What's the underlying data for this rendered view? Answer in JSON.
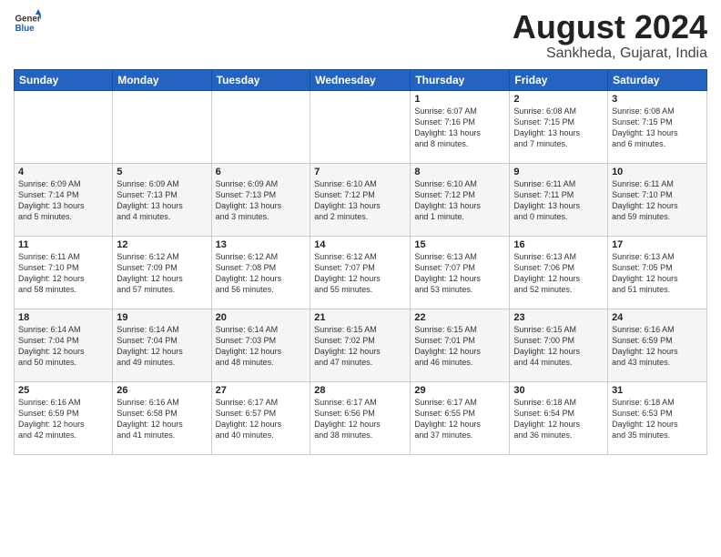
{
  "logo": {
    "general": "General",
    "blue": "Blue"
  },
  "title": "August 2024",
  "subtitle": "Sankheda, Gujarat, India",
  "days": [
    "Sunday",
    "Monday",
    "Tuesday",
    "Wednesday",
    "Thursday",
    "Friday",
    "Saturday"
  ],
  "weeks": [
    [
      {
        "num": "",
        "info": ""
      },
      {
        "num": "",
        "info": ""
      },
      {
        "num": "",
        "info": ""
      },
      {
        "num": "",
        "info": ""
      },
      {
        "num": "1",
        "info": "Sunrise: 6:07 AM\nSunset: 7:16 PM\nDaylight: 13 hours\nand 8 minutes."
      },
      {
        "num": "2",
        "info": "Sunrise: 6:08 AM\nSunset: 7:15 PM\nDaylight: 13 hours\nand 7 minutes."
      },
      {
        "num": "3",
        "info": "Sunrise: 6:08 AM\nSunset: 7:15 PM\nDaylight: 13 hours\nand 6 minutes."
      }
    ],
    [
      {
        "num": "4",
        "info": "Sunrise: 6:09 AM\nSunset: 7:14 PM\nDaylight: 13 hours\nand 5 minutes."
      },
      {
        "num": "5",
        "info": "Sunrise: 6:09 AM\nSunset: 7:13 PM\nDaylight: 13 hours\nand 4 minutes."
      },
      {
        "num": "6",
        "info": "Sunrise: 6:09 AM\nSunset: 7:13 PM\nDaylight: 13 hours\nand 3 minutes."
      },
      {
        "num": "7",
        "info": "Sunrise: 6:10 AM\nSunset: 7:12 PM\nDaylight: 13 hours\nand 2 minutes."
      },
      {
        "num": "8",
        "info": "Sunrise: 6:10 AM\nSunset: 7:12 PM\nDaylight: 13 hours\nand 1 minute."
      },
      {
        "num": "9",
        "info": "Sunrise: 6:11 AM\nSunset: 7:11 PM\nDaylight: 13 hours\nand 0 minutes."
      },
      {
        "num": "10",
        "info": "Sunrise: 6:11 AM\nSunset: 7:10 PM\nDaylight: 12 hours\nand 59 minutes."
      }
    ],
    [
      {
        "num": "11",
        "info": "Sunrise: 6:11 AM\nSunset: 7:10 PM\nDaylight: 12 hours\nand 58 minutes."
      },
      {
        "num": "12",
        "info": "Sunrise: 6:12 AM\nSunset: 7:09 PM\nDaylight: 12 hours\nand 57 minutes."
      },
      {
        "num": "13",
        "info": "Sunrise: 6:12 AM\nSunset: 7:08 PM\nDaylight: 12 hours\nand 56 minutes."
      },
      {
        "num": "14",
        "info": "Sunrise: 6:12 AM\nSunset: 7:07 PM\nDaylight: 12 hours\nand 55 minutes."
      },
      {
        "num": "15",
        "info": "Sunrise: 6:13 AM\nSunset: 7:07 PM\nDaylight: 12 hours\nand 53 minutes."
      },
      {
        "num": "16",
        "info": "Sunrise: 6:13 AM\nSunset: 7:06 PM\nDaylight: 12 hours\nand 52 minutes."
      },
      {
        "num": "17",
        "info": "Sunrise: 6:13 AM\nSunset: 7:05 PM\nDaylight: 12 hours\nand 51 minutes."
      }
    ],
    [
      {
        "num": "18",
        "info": "Sunrise: 6:14 AM\nSunset: 7:04 PM\nDaylight: 12 hours\nand 50 minutes."
      },
      {
        "num": "19",
        "info": "Sunrise: 6:14 AM\nSunset: 7:04 PM\nDaylight: 12 hours\nand 49 minutes."
      },
      {
        "num": "20",
        "info": "Sunrise: 6:14 AM\nSunset: 7:03 PM\nDaylight: 12 hours\nand 48 minutes."
      },
      {
        "num": "21",
        "info": "Sunrise: 6:15 AM\nSunset: 7:02 PM\nDaylight: 12 hours\nand 47 minutes."
      },
      {
        "num": "22",
        "info": "Sunrise: 6:15 AM\nSunset: 7:01 PM\nDaylight: 12 hours\nand 46 minutes."
      },
      {
        "num": "23",
        "info": "Sunrise: 6:15 AM\nSunset: 7:00 PM\nDaylight: 12 hours\nand 44 minutes."
      },
      {
        "num": "24",
        "info": "Sunrise: 6:16 AM\nSunset: 6:59 PM\nDaylight: 12 hours\nand 43 minutes."
      }
    ],
    [
      {
        "num": "25",
        "info": "Sunrise: 6:16 AM\nSunset: 6:59 PM\nDaylight: 12 hours\nand 42 minutes."
      },
      {
        "num": "26",
        "info": "Sunrise: 6:16 AM\nSunset: 6:58 PM\nDaylight: 12 hours\nand 41 minutes."
      },
      {
        "num": "27",
        "info": "Sunrise: 6:17 AM\nSunset: 6:57 PM\nDaylight: 12 hours\nand 40 minutes."
      },
      {
        "num": "28",
        "info": "Sunrise: 6:17 AM\nSunset: 6:56 PM\nDaylight: 12 hours\nand 38 minutes."
      },
      {
        "num": "29",
        "info": "Sunrise: 6:17 AM\nSunset: 6:55 PM\nDaylight: 12 hours\nand 37 minutes."
      },
      {
        "num": "30",
        "info": "Sunrise: 6:18 AM\nSunset: 6:54 PM\nDaylight: 12 hours\nand 36 minutes."
      },
      {
        "num": "31",
        "info": "Sunrise: 6:18 AM\nSunset: 6:53 PM\nDaylight: 12 hours\nand 35 minutes."
      }
    ]
  ]
}
